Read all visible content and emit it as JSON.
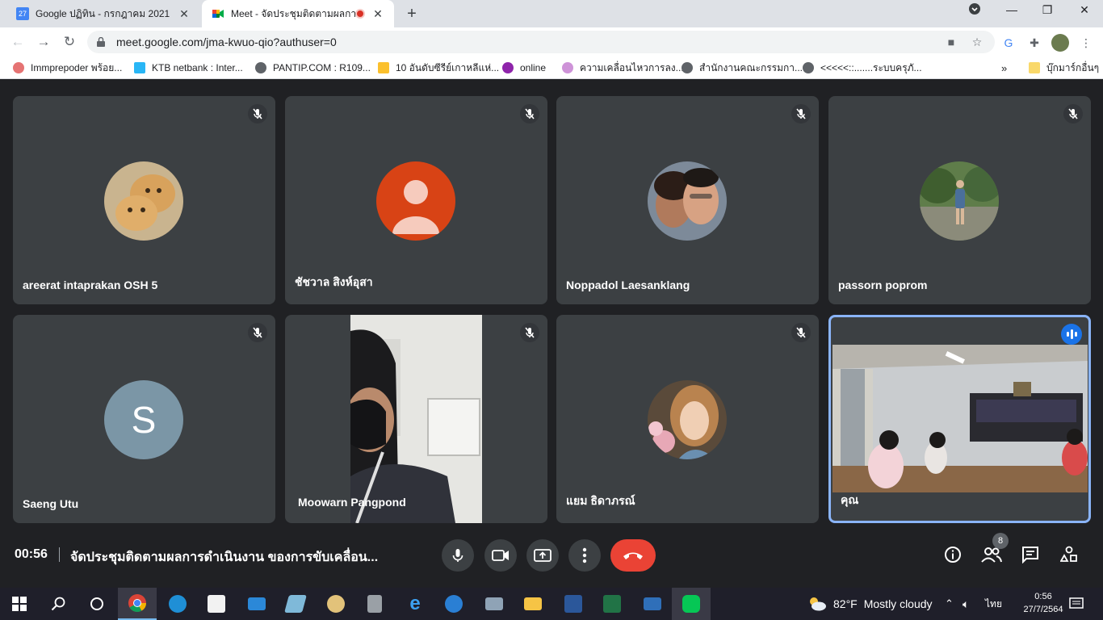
{
  "browser": {
    "tabs": [
      {
        "title": "Google ปฏิทิน - กรกฎาคม 2021",
        "favicon": "calendar-icon"
      },
      {
        "title": "Meet - จัดประชุมติดตามผลการด",
        "favicon": "meet-icon",
        "recording": true
      }
    ],
    "url": "meet.google.com/jma-kwuo-qio?authuser=0",
    "bookmarks": [
      "Immprepoder พร้อย...",
      "KTB netbank : Inter...",
      "PANTIP.COM : R109...",
      "10 อันดับซีรีย์เกาหลีแห่...",
      "online",
      "ความเคลื่อนไหวการลง...",
      "สำนักงานคณะกรรมกา...",
      "<<<<<::.......ระบบครุภั...",
      "บุ๊กมาร์กอื่นๆ"
    ],
    "colors": {
      "tabstrip": "#dee1e6",
      "active_tab": "#ffffff"
    }
  },
  "meeting": {
    "time": "00:56",
    "title": "จัดประชุมติดตามผลการดำเนินงาน ของการขับเคลื่อน...",
    "participant_count": "8",
    "participants": [
      {
        "name": "areerat intaprakan OSH 5",
        "avatar": "cat-photo",
        "muted": true
      },
      {
        "name": "ชัชวาล สิงห์อุสา",
        "avatar": "default-person",
        "muted": true
      },
      {
        "name": "Noppadol Laesanklang",
        "avatar": "couple-photo",
        "muted": true
      },
      {
        "name": "passorn poprom",
        "avatar": "outdoor-photo",
        "muted": true
      },
      {
        "name": "Saeng Utu",
        "avatar": "letter",
        "letter": "S",
        "muted": true
      },
      {
        "name": "Moowarn Pangpond",
        "avatar": "camera-video",
        "muted": true
      },
      {
        "name": "แยม ธิดาภรณ์",
        "avatar": "portrait-photo",
        "muted": true
      },
      {
        "name": "คุณ",
        "avatar": "camera-video",
        "speaking": true
      }
    ],
    "colors": {
      "end_call": "#ea4335",
      "speaking_border": "#8ab4f8",
      "tile_bg": "#3c4043"
    }
  },
  "taskbar": {
    "weather_temp": "82°F",
    "weather_text": "Mostly cloudy",
    "language": "ไทย",
    "time": "0:56",
    "date": "27/7/2564"
  }
}
